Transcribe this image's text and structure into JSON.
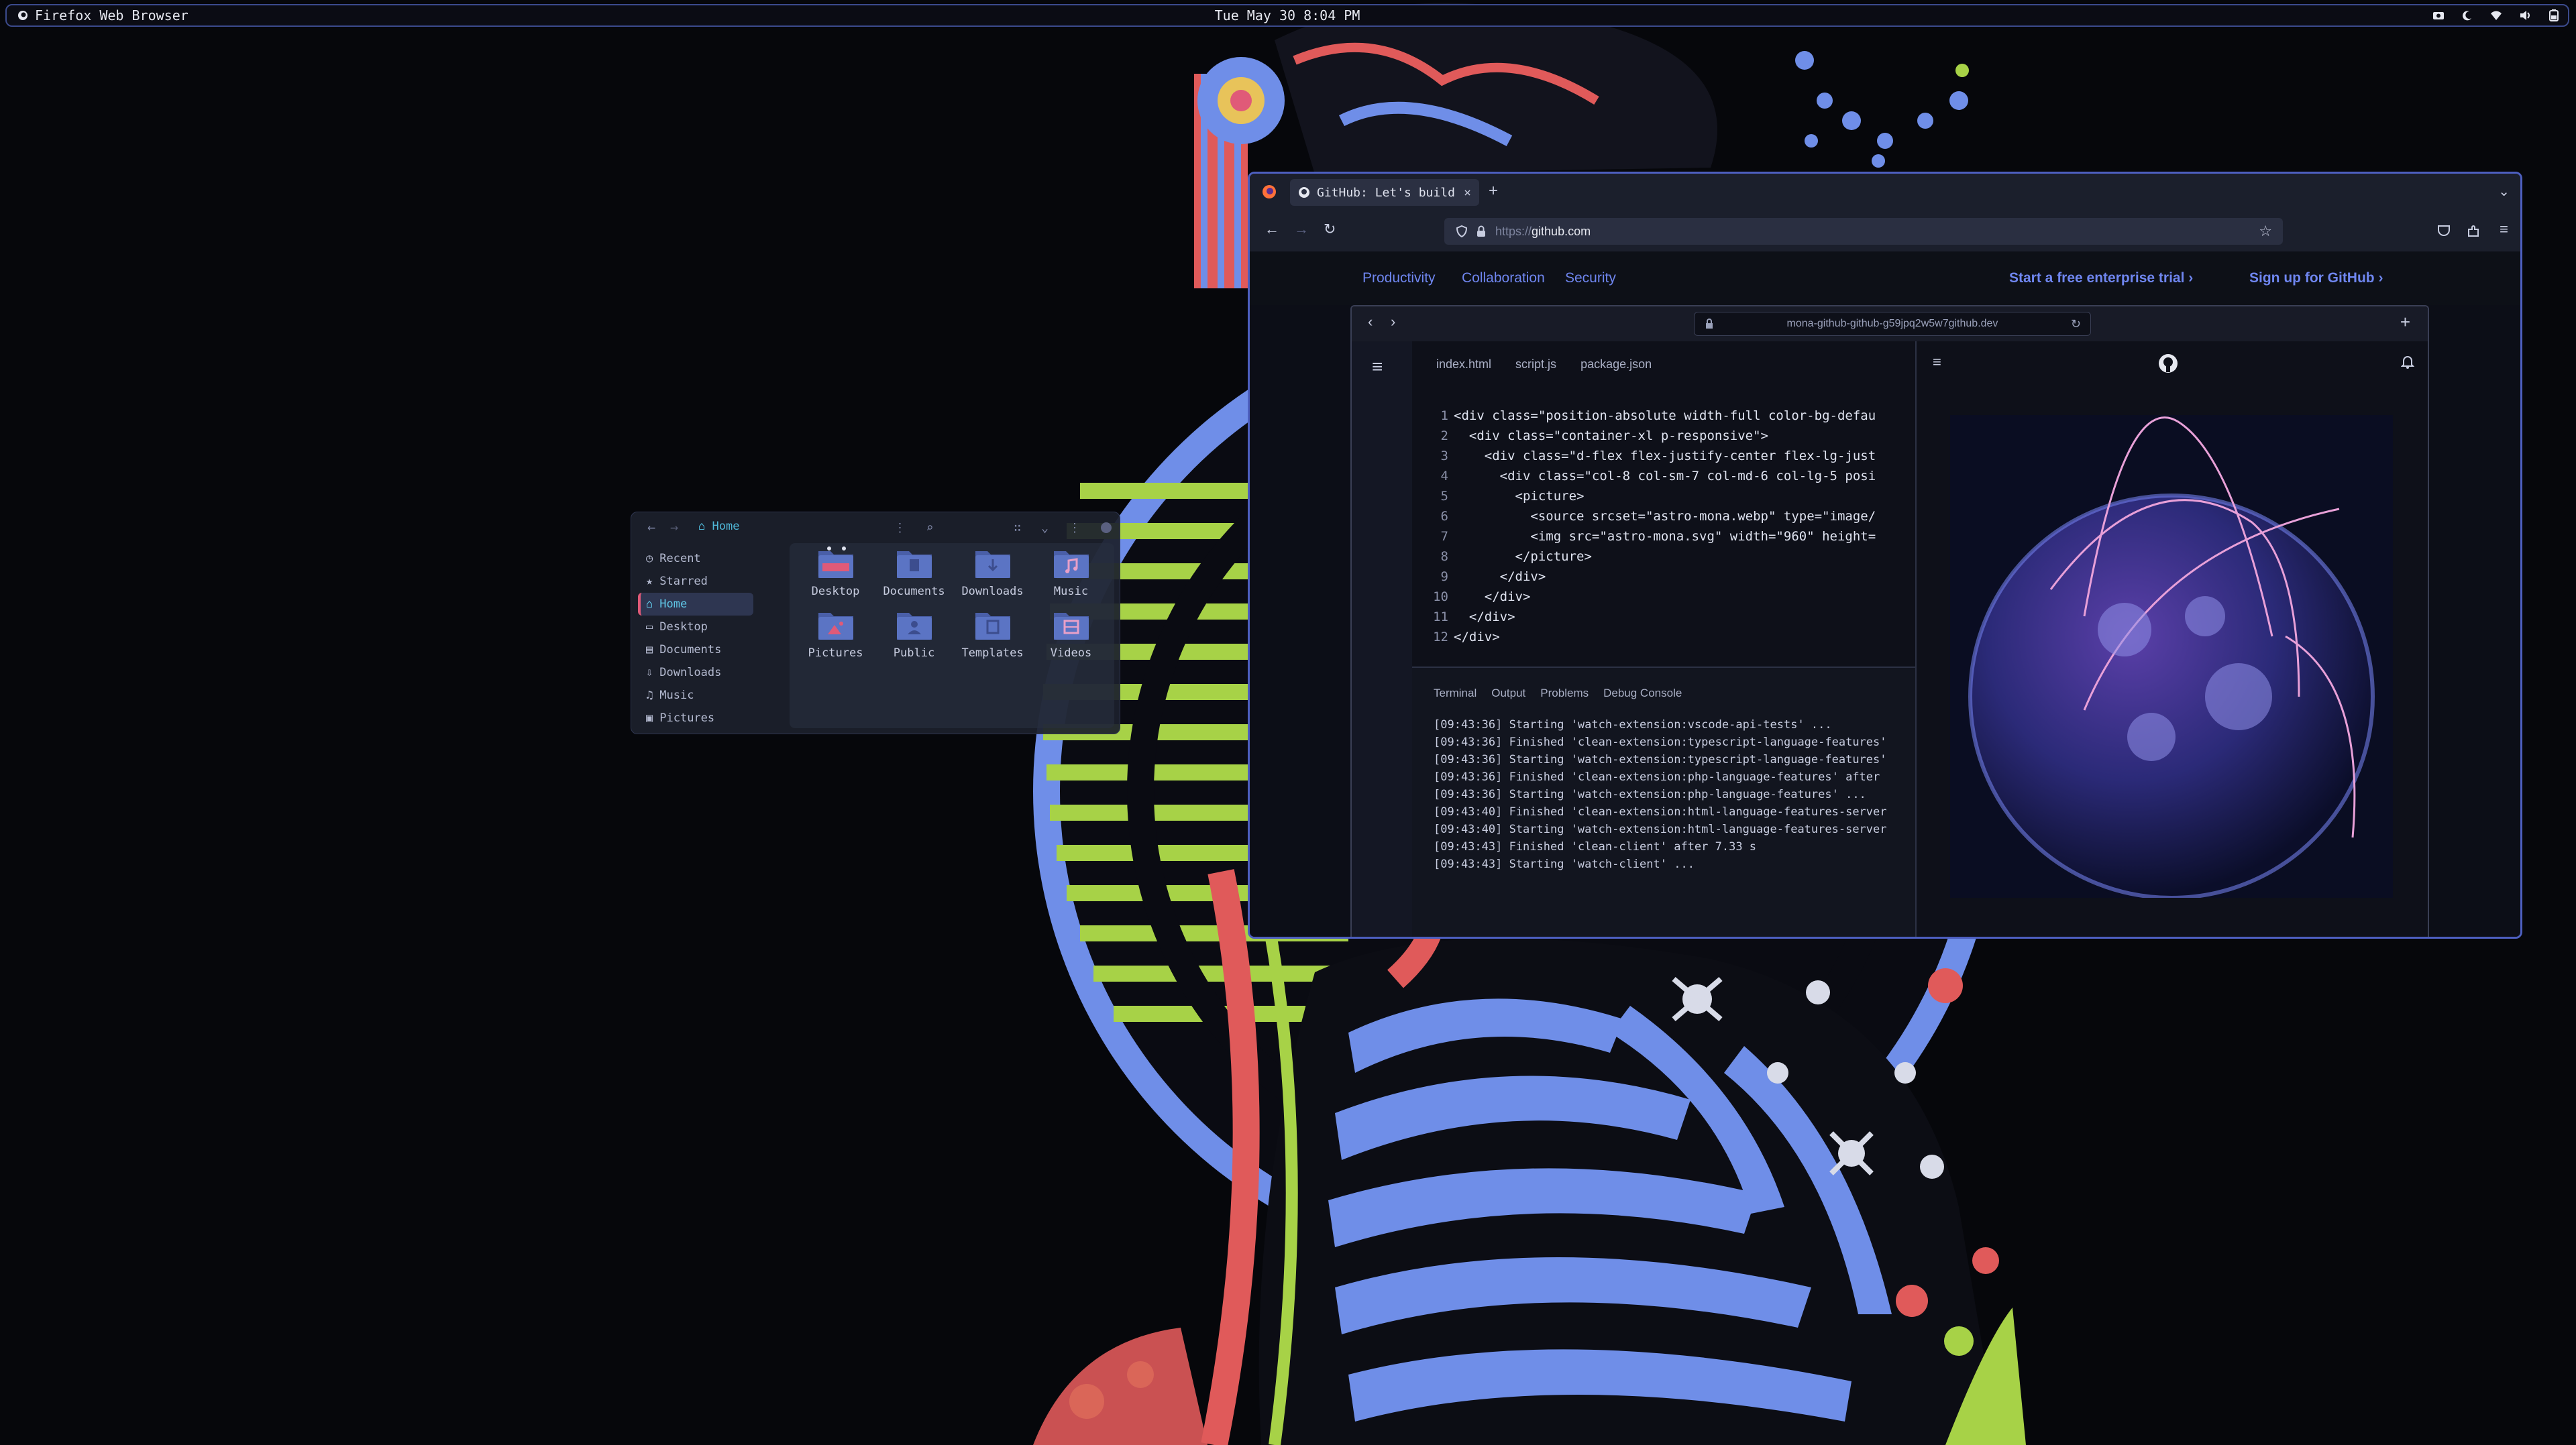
{
  "topbar": {
    "app_name": "Firefox Web Browser",
    "datetime": "Tue May 30  8:04 PM",
    "tray_icons": [
      "screenshot-icon",
      "moon-icon",
      "wifi-icon",
      "volume-icon",
      "battery-icon"
    ]
  },
  "file_manager": {
    "location": "Home",
    "sidebar": [
      {
        "label": "Recent",
        "icon": "clock-icon"
      },
      {
        "label": "Starred",
        "icon": "star-icon"
      },
      {
        "label": "Home",
        "icon": "home-icon",
        "active": true
      },
      {
        "label": "Desktop",
        "icon": "desktop-icon"
      },
      {
        "label": "Documents",
        "icon": "document-icon"
      },
      {
        "label": "Downloads",
        "icon": "download-icon"
      },
      {
        "label": "Music",
        "icon": "music-icon"
      },
      {
        "label": "Pictures",
        "icon": "picture-icon"
      }
    ],
    "folders": [
      "Desktop",
      "Documents",
      "Downloads",
      "Music",
      "Pictures",
      "Public",
      "Templates",
      "Videos"
    ]
  },
  "browser": {
    "tab_title": "GitHub: Let's build",
    "url_scheme": "https://",
    "url_host": "github.com",
    "nav_links": [
      "Productivity",
      "Collaboration",
      "Security"
    ],
    "cta_trial": "Start a free enterprise trial",
    "cta_signup": "Sign up for GitHub"
  },
  "codespace": {
    "address": "mona-github-github-g59jpq2w5w7github.dev",
    "file_tabs": [
      "index.html",
      "script.js",
      "package.json"
    ],
    "code_lines": [
      "<div class=\"position-absolute width-full color-bg-defau",
      "  <div class=\"container-xl p-responsive\">",
      "    <div class=\"d-flex flex-justify-center flex-lg-just",
      "      <div class=\"col-8 col-sm-7 col-md-6 col-lg-5 posi",
      "        <picture>",
      "          <source srcset=\"astro-mona.webp\" type=\"image/",
      "          <img src=\"astro-mona.svg\" width=\"960\" height=",
      "        </picture>",
      "      </div>",
      "    </div>",
      "  </div>",
      "</div>"
    ],
    "terminal_tabs": [
      "Terminal",
      "Output",
      "Problems",
      "Debug Console"
    ],
    "terminal_lines": [
      "[09:43:36] Starting 'watch-extension:vscode-api-tests' ...",
      "[09:43:36] Finished 'clean-extension:typescript-language-features'",
      "[09:43:36] Starting 'watch-extension:typescript-language-features'",
      "[09:43:36] Finished 'clean-extension:php-language-features' after",
      "[09:43:36] Starting 'watch-extension:php-language-features' ...",
      "[09:43:40] Finished 'clean-extension:html-language-features-server",
      "[09:43:40] Starting 'watch-extension:html-language-features-server",
      "[09:43:43] Finished 'clean-client' after 7.33 s",
      "[09:43:43] Starting 'watch-client' ..."
    ]
  },
  "colors": {
    "accent_blue": "#4d5fc0",
    "link_blue": "#6f86f0",
    "folder_blue": "#4a5fa8",
    "active_pink": "#e05a78",
    "lime": "#a7d247"
  }
}
